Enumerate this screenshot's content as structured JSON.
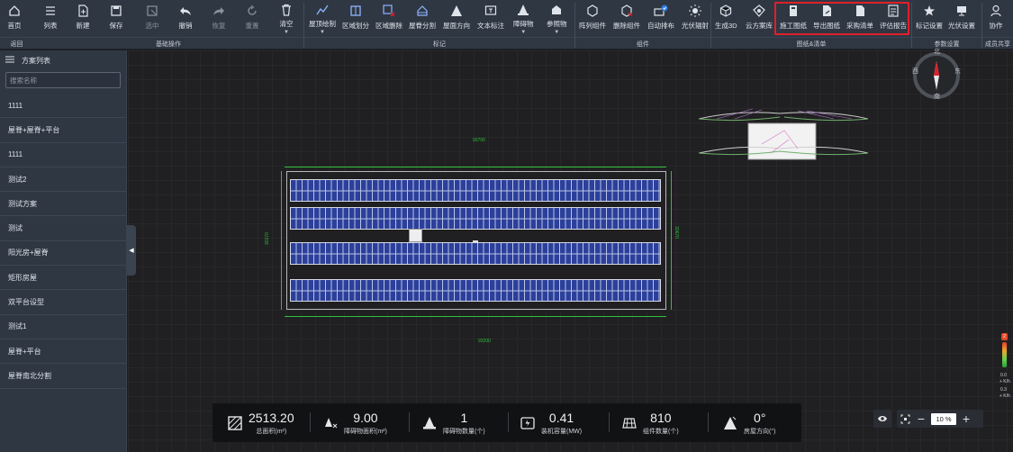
{
  "toolbar": {
    "items": [
      {
        "label": "首页",
        "icon": "home-icon"
      },
      {
        "label": "列表",
        "icon": "list-icon"
      },
      {
        "label": "新建",
        "icon": "new-file-icon"
      },
      {
        "label": "保存",
        "icon": "save-icon"
      },
      {
        "label": "选中",
        "icon": "select-icon"
      },
      {
        "label": "撤销",
        "icon": "undo-icon"
      },
      {
        "label": "恢复",
        "icon": "redo-icon"
      },
      {
        "label": "重置",
        "icon": "reset-icon"
      },
      {
        "label": "清空",
        "icon": "trash-icon"
      },
      {
        "label": "屋顶绘制",
        "icon": "roof-draw-icon"
      },
      {
        "label": "区域划分",
        "icon": "area-divide-icon"
      },
      {
        "label": "区域删除",
        "icon": "area-delete-icon"
      },
      {
        "label": "屋脊分割",
        "icon": "ridge-split-icon"
      },
      {
        "label": "屋面方向",
        "icon": "roof-direction-icon"
      },
      {
        "label": "文本标注",
        "icon": "text-label-icon"
      },
      {
        "label": "障碍物",
        "icon": "obstacle-icon"
      },
      {
        "label": "参照物",
        "icon": "reference-icon"
      },
      {
        "label": "阵列组件",
        "icon": "array-module-icon"
      },
      {
        "label": "删除组件",
        "icon": "delete-module-icon"
      },
      {
        "label": "自动排布",
        "icon": "auto-layout-icon"
      },
      {
        "label": "光伏辐射",
        "icon": "pv-radiation-icon"
      },
      {
        "label": "生成3D",
        "icon": "generate-3d-icon"
      },
      {
        "label": "云方案库",
        "icon": "cloud-library-icon"
      },
      {
        "label": "施工图纸",
        "icon": "construction-drawing-icon"
      },
      {
        "label": "导出图纸",
        "icon": "export-drawing-icon"
      },
      {
        "label": "采购清单",
        "icon": "purchase-list-icon"
      },
      {
        "label": "评估报告",
        "icon": "evaluation-report-icon"
      },
      {
        "label": "标记设置",
        "icon": "marker-settings-icon"
      },
      {
        "label": "光伏设置",
        "icon": "pv-settings-icon"
      },
      {
        "label": "协作",
        "icon": "collaborate-icon"
      }
    ],
    "groups": [
      "返回",
      "基础操作",
      "标记",
      "组件",
      "图纸&清单",
      "参数设置",
      "成员共享"
    ]
  },
  "sidebar": {
    "title": "方案列表",
    "search_placeholder": "搜索名称",
    "items": [
      "1111",
      "屋脊+屋脊+平台",
      "1111",
      "测试2",
      "测试方案",
      "测试",
      "阳光房+屋脊",
      "矩形房屋",
      "双平台设型",
      "测试1",
      "屋脊+平台",
      "屋脊南北分割"
    ]
  },
  "canvas": {
    "dim_top": "93700",
    "dim_bottom": "93200",
    "dim_left": "30170",
    "dim_right": "30670",
    "panel_rows": 4,
    "compass": {
      "north": "北",
      "south": "南",
      "east": "东",
      "west": "西"
    },
    "legend": {
      "badge": "2",
      "val1": "0.0",
      "unit1": "+ K/h",
      "val2": "0.3",
      "unit2": "+ K/h"
    }
  },
  "stats": [
    {
      "value": "2513.20",
      "label": "总面积(m²)",
      "icon": "area-icon"
    },
    {
      "value": "9.00",
      "label": "障碍物面积(m²)",
      "icon": "obstacle-area-icon"
    },
    {
      "value": "1",
      "label": "障碍物数量(个)",
      "icon": "obstacle-count-icon"
    },
    {
      "value": "0.41",
      "label": "装机容量(MW)",
      "icon": "capacity-icon"
    },
    {
      "value": "810",
      "label": "组件数量(个)",
      "icon": "module-count-icon"
    },
    {
      "value": "0°",
      "label": "房屋方向(°)",
      "icon": "direction-icon"
    }
  ],
  "zoom": {
    "value": "10 %",
    "minus": "−",
    "plus": "+"
  },
  "colors": {
    "accent_red": "#e0202a",
    "panel_blue": "#2c3f9a",
    "dimension_green": "#2fbf3a"
  }
}
